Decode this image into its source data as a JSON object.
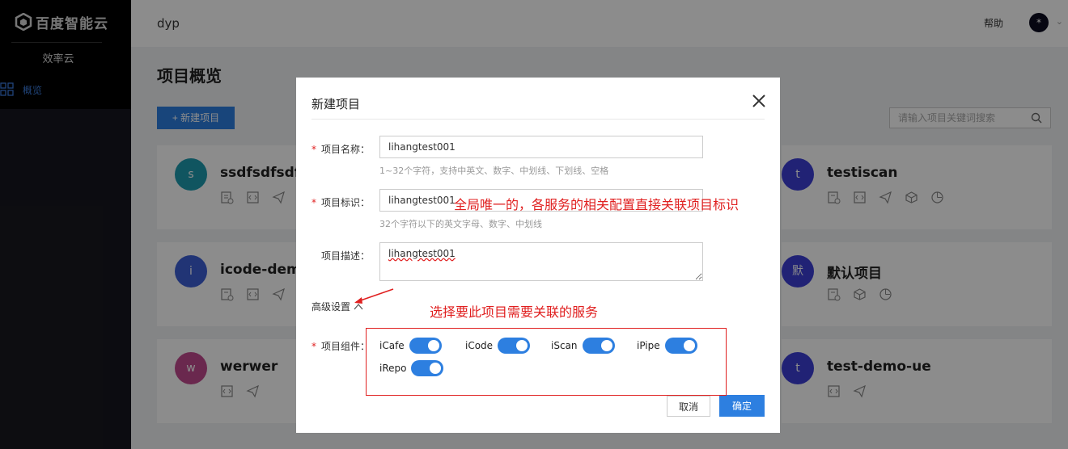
{
  "sidebar": {
    "logo_text": "百度智能云",
    "product": "效率云",
    "nav_overview": "概览"
  },
  "header": {
    "title": "dyp",
    "help": "帮助",
    "avatar": "*"
  },
  "main": {
    "page_title": "项目概览",
    "new_button": "+ 新建项目",
    "search_placeholder": "请输入项目关键词搜索",
    "cards": [
      {
        "avatar": "s",
        "name": "ssdfsdfsdf",
        "color": "#1e9bb0"
      },
      {
        "avatar": "i",
        "name": "icode-demo",
        "color": "#3c5fd6"
      },
      {
        "avatar": "w",
        "name": "werwer",
        "color": "#c24a8e"
      },
      {
        "avatar": "t",
        "name": "testiscan",
        "color": "#3c3fd6"
      },
      {
        "avatar": "默",
        "name": "默认项目",
        "color": "#3c3fd6"
      },
      {
        "avatar": "t",
        "name": "test-demo-ue",
        "color": "#3c3fd6"
      }
    ]
  },
  "modal": {
    "title": "新建项目",
    "name_label": "项目名称：",
    "name_value": "lihangtest001",
    "name_hint": "1~32个字符，支持中英文、数字、中划线、下划线、空格",
    "id_label": "项目标识：",
    "id_value": "lihangtest001",
    "id_hint": "32个字符以下的英文字母、数字、中划线",
    "desc_label": "项目描述：",
    "desc_value": "lihangtest001",
    "advanced": "高级设置",
    "components_label": "项目组件：",
    "components": [
      "iCafe",
      "iCode",
      "iScan",
      "iPipe",
      "iRepo"
    ],
    "cancel": "取消",
    "ok": "确定"
  },
  "annotations": {
    "id_note": "全局唯一的，各服务的相关配置直接关联项目标识",
    "service_note": "选择要此项目需要关联的服务"
  },
  "colors": {
    "primary": "#2d7fe0",
    "annotation": "#e02020"
  }
}
